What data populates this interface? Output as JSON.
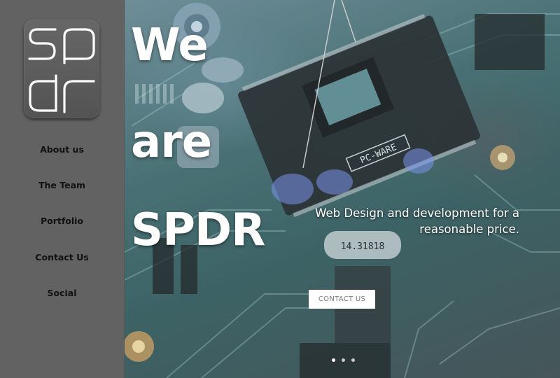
{
  "logo": {
    "line1": "sp",
    "line2": "dr"
  },
  "nav": {
    "items": [
      {
        "label": "About us"
      },
      {
        "label": "The Team"
      },
      {
        "label": "Portfolio"
      },
      {
        "label": "Contact Us"
      },
      {
        "label": "Social"
      }
    ]
  },
  "hero": {
    "title_lines": [
      "We",
      "are",
      "SPDR"
    ],
    "tagline_line1": "Web Design and development for a",
    "tagline_line2": "reasonable price.",
    "cta_label": "CONTACT US",
    "chip_marking": "PC-WARE",
    "crystal_marking": "14.31818",
    "slides": {
      "count": 3,
      "active": 1
    }
  },
  "colors": {
    "sidebar": "#626262",
    "nav_text": "#111111",
    "hero_text": "#ffffff",
    "cta_bg": "#ffffff",
    "cta_text": "#7b7b7b"
  }
}
